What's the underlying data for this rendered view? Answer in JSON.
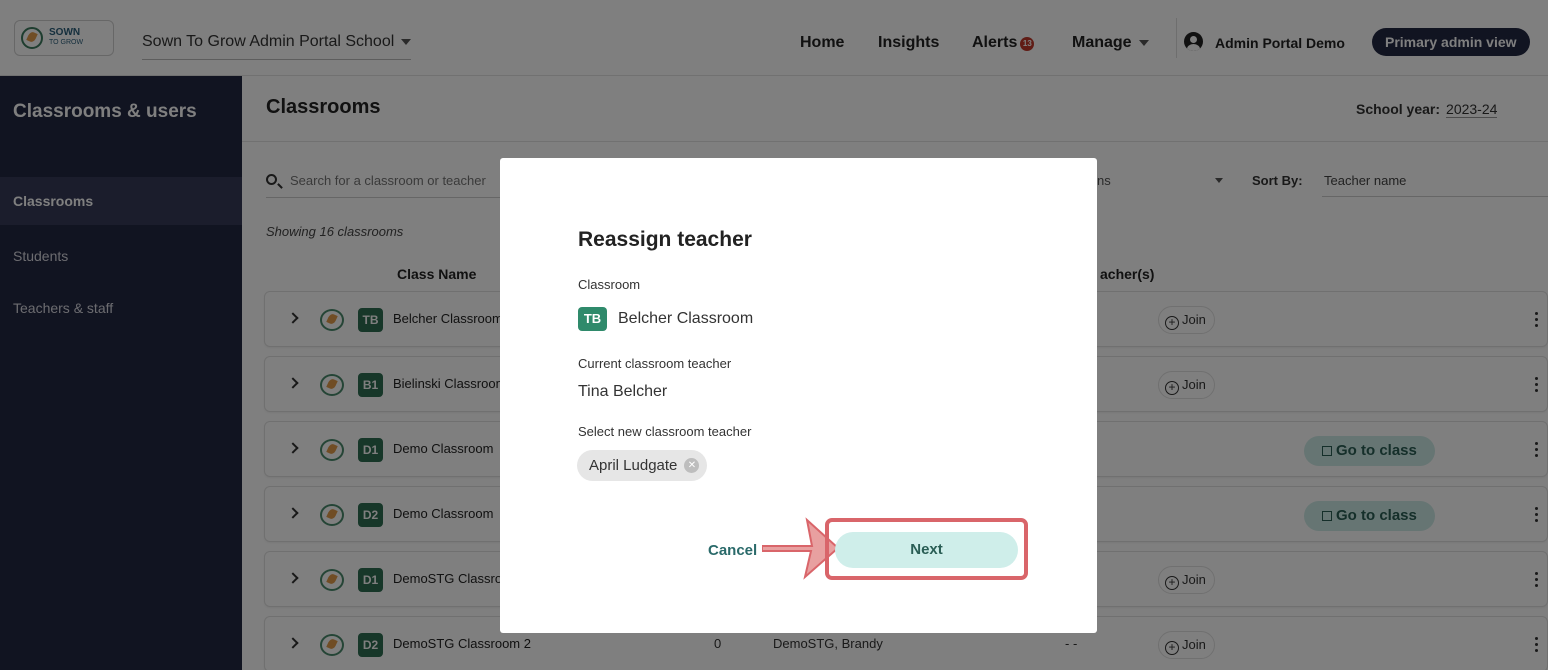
{
  "topbar": {
    "logo_text": "SOWN",
    "logo_subtext": "TO GROW",
    "school": "Sown To Grow Admin Portal School",
    "nav": {
      "home": "Home",
      "insights": "Insights",
      "alerts": "Alerts",
      "alerts_count": "13",
      "manage": "Manage"
    },
    "user_name": "Admin Portal Demo",
    "role": "Primary admin view"
  },
  "sidebar": {
    "title": "Classrooms & users",
    "items": [
      {
        "label": "Classrooms",
        "active": true
      },
      {
        "label": "Students",
        "active": false
      },
      {
        "label": "Teachers & staff",
        "active": false
      }
    ]
  },
  "main": {
    "title": "Classrooms",
    "school_year_label": "School year:",
    "school_year_value": "2023-24",
    "search_placeholder": "Search for a classroom or teacher",
    "filter_text": "ns",
    "sort_label": "Sort By:",
    "sort_value": "Teacher name",
    "showing": "Showing 16 classrooms",
    "columns": {
      "class_name": "Class Name",
      "teachers": "acher(s)"
    },
    "rows": [
      {
        "badge": "TB",
        "name": "Belcher Classroom",
        "count": "",
        "teacher": "",
        "dashes": "",
        "action": "Join"
      },
      {
        "badge": "B1",
        "name": "Bielinski Classroom",
        "count": "",
        "teacher": "",
        "dashes": "",
        "action": "Join"
      },
      {
        "badge": "D1",
        "name": "Demo Classroom",
        "count": "",
        "teacher": "",
        "dashes": "",
        "action": "Go to class"
      },
      {
        "badge": "D2",
        "name": "Demo Classroom",
        "count": "",
        "teacher": "",
        "dashes": "",
        "action": "Go to class"
      },
      {
        "badge": "D1",
        "name": "DemoSTG Classroom",
        "count": "",
        "teacher": "",
        "dashes": "",
        "action": "Join"
      },
      {
        "badge": "D2",
        "name": "DemoSTG Classroom 2",
        "count": "0",
        "teacher": "DemoSTG, Brandy",
        "dashes": "- -",
        "action": "Join"
      }
    ]
  },
  "modal": {
    "title": "Reassign teacher",
    "classroom_label": "Classroom",
    "classroom_badge": "TB",
    "classroom_name": "Belcher Classroom",
    "current_label": "Current classroom teacher",
    "current_teacher": "Tina Belcher",
    "select_label": "Select new classroom teacher",
    "selected_teacher": "April Ludgate",
    "cancel": "Cancel",
    "next": "Next"
  },
  "colors": {
    "sidebar_bg": "#232843",
    "badge_green": "#2f6e52",
    "next_bg": "#cfeeea",
    "annotation_red": "#d9656a"
  }
}
